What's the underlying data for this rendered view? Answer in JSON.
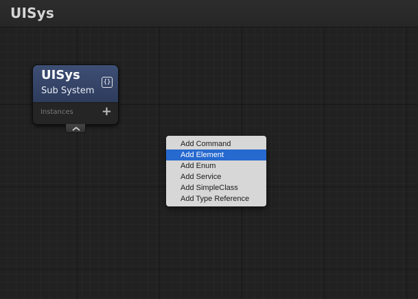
{
  "window": {
    "title": "UISys"
  },
  "node": {
    "title": "UISys",
    "subtitle": "Sub System",
    "type_icon": "{}",
    "section_label": "Instances",
    "add_icon": "+",
    "header_color": "#34446a"
  },
  "context_menu": {
    "items": [
      {
        "label": "Add Command",
        "selected": false
      },
      {
        "label": "Add Element",
        "selected": true
      },
      {
        "label": "Add Enum",
        "selected": false
      },
      {
        "label": "Add Service",
        "selected": false
      },
      {
        "label": "Add SimpleClass",
        "selected": false
      },
      {
        "label": "Add Type Reference",
        "selected": false
      }
    ],
    "selection_color": "#2669cf"
  }
}
